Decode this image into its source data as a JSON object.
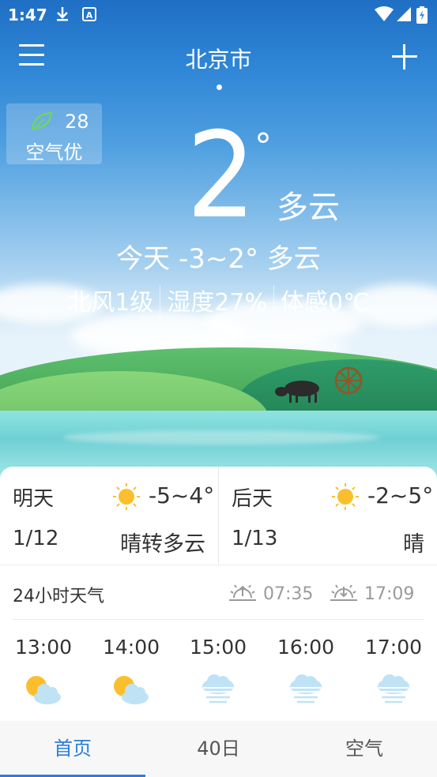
{
  "status_bar": {
    "time": "1:47"
  },
  "header": {
    "city": "北京市"
  },
  "aqi": {
    "value": "28",
    "label": "空气优"
  },
  "current": {
    "temperature": "2",
    "degree_symbol": "°",
    "condition": "多云",
    "today_summary": "今天 -3~2° 多云",
    "wind": "北风1级",
    "humidity": "湿度27%",
    "feels_like": "体感0℃"
  },
  "forecast": [
    {
      "day": "明天",
      "date": "1/12",
      "range": "-5~4°",
      "desc": "晴转多云"
    },
    {
      "day": "后天",
      "date": "1/13",
      "range": "-2~5°",
      "desc": "晴"
    }
  ],
  "hourly_section": {
    "title": "24小时天气",
    "sunrise": "07:35",
    "sunset": "17:09"
  },
  "hourly": [
    {
      "time": "13:00",
      "icon": "partly-cloudy-icon"
    },
    {
      "time": "14:00",
      "icon": "partly-cloudy-icon"
    },
    {
      "time": "15:00",
      "icon": "haze-icon"
    },
    {
      "time": "16:00",
      "icon": "haze-icon"
    },
    {
      "time": "17:00",
      "icon": "haze-icon"
    }
  ],
  "nav": {
    "home": "首页",
    "forty_day": "40日",
    "air": "空气"
  },
  "colors": {
    "accent": "#2b7ed8",
    "sun": "#fbbf2e",
    "leaf": "#6fd36b"
  }
}
